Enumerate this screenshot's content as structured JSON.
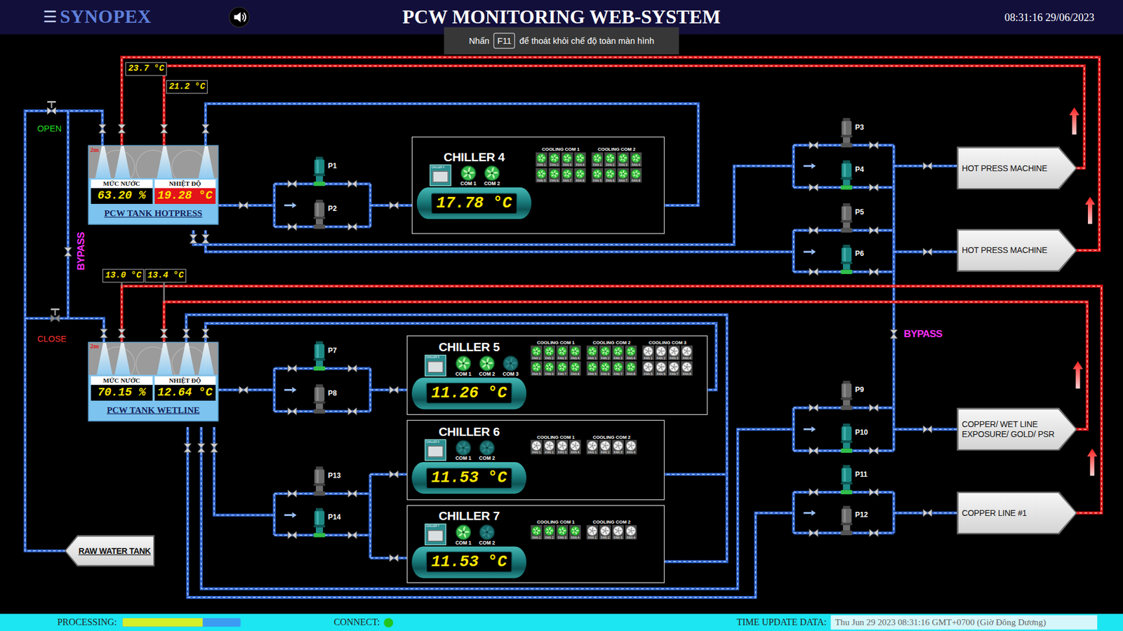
{
  "header": {
    "menu_icon": "☰",
    "logo": "SYNOPEX",
    "sound_on": true,
    "title": "PCW MONITORING WEB-SYSTEM",
    "clock": "08:31:16 29/06/2023"
  },
  "fullscreen_hint": {
    "before": "Nhấn",
    "key": "F11",
    "after": "để thoát khỏi chế độ toàn màn hình"
  },
  "sensors": [
    {
      "value": "23.7 °C"
    },
    {
      "value": "21.2 °C"
    },
    {
      "value": "13.0 °C"
    },
    {
      "value": "13.4 °C"
    }
  ],
  "manual_valves": [
    {
      "label": "OPEN",
      "open": true
    },
    {
      "label": "CLOSE",
      "open": false
    }
  ],
  "bypass_labels": [
    {
      "label": "BYPASS"
    },
    {
      "label": "BYPASS"
    }
  ],
  "tanks": [
    {
      "name": "PCW TANK HOTPRESS",
      "scale": "2m",
      "level_label": "MỨC NƯỚC",
      "level_value": "63.20 %",
      "temp_label": "NHIỆT ĐỘ",
      "temp_value": "19.28 °C",
      "temp_alarm": true
    },
    {
      "name": "PCW TANK WETLINE",
      "scale": "2m",
      "level_label": "MỨC NƯỚC",
      "level_value": "70.15 %",
      "temp_label": "NHIỆT ĐỘ",
      "temp_value": "12.64 °C",
      "temp_alarm": false
    }
  ],
  "pumps": [
    {
      "label": "P1",
      "running": true
    },
    {
      "label": "P2",
      "running": false
    },
    {
      "label": "P3",
      "running": false
    },
    {
      "label": "P4",
      "running": true
    },
    {
      "label": "P5",
      "running": false
    },
    {
      "label": "P6",
      "running": true
    },
    {
      "label": "P7",
      "running": true
    },
    {
      "label": "P8",
      "running": false
    },
    {
      "label": "P9",
      "running": false
    },
    {
      "label": "P10",
      "running": true
    },
    {
      "label": "P11",
      "running": true
    },
    {
      "label": "P12",
      "running": false
    },
    {
      "label": "P13",
      "running": false
    },
    {
      "label": "P14",
      "running": true
    }
  ],
  "chillers": [
    {
      "name": "CHILLER 4",
      "panel_label": "CHILLER 4",
      "temp": "17.78 °C",
      "coms": [
        {
          "label": "COM 1",
          "on": true
        },
        {
          "label": "COM 2",
          "on": true
        }
      ],
      "cooling": [
        {
          "label": "COOLING COM 1",
          "fans": [
            {
              "label": "FAN 1",
              "on": true
            },
            {
              "label": "FAN 2",
              "on": true
            },
            {
              "label": "FAN 3",
              "on": true
            },
            {
              "label": "FAN 4",
              "on": true
            },
            {
              "label": "FAN 5",
              "on": true
            },
            {
              "label": "FAN 6",
              "on": true
            },
            {
              "label": "FAN 7",
              "on": true
            },
            {
              "label": "FAN 8",
              "on": true
            }
          ]
        },
        {
          "label": "COOLING COM 2",
          "fans": [
            {
              "label": "FAN 1",
              "on": true
            },
            {
              "label": "FAN 2",
              "on": true
            },
            {
              "label": "FAN 3",
              "on": true
            },
            {
              "label": "FAN 4",
              "on": true
            },
            {
              "label": "FAN 5",
              "on": true
            },
            {
              "label": "FAN 6",
              "on": true
            },
            {
              "label": "FAN 7",
              "on": true
            },
            {
              "label": "FAN 8",
              "on": true
            }
          ]
        }
      ]
    },
    {
      "name": "CHILLER 5",
      "panel_label": "CHILLER 5",
      "temp": "11.26 °C",
      "coms": [
        {
          "label": "COM 1",
          "on": true
        },
        {
          "label": "COM 2",
          "on": true
        },
        {
          "label": "COM 3",
          "on": false
        }
      ],
      "cooling": [
        {
          "label": "COOLING COM 1",
          "fans": [
            {
              "label": "FAN 1",
              "on": true
            },
            {
              "label": "FAN 2",
              "on": true
            },
            {
              "label": "FAN 3",
              "on": true
            },
            {
              "label": "FAN 4",
              "on": true
            },
            {
              "label": "FAN 5",
              "on": true
            },
            {
              "label": "FAN 6",
              "on": true
            },
            {
              "label": "FAN 7",
              "on": true
            },
            {
              "label": "FAN 8",
              "on": true
            }
          ]
        },
        {
          "label": "COOLING COM 2",
          "fans": [
            {
              "label": "FAN 1",
              "on": true
            },
            {
              "label": "FAN 2",
              "on": true
            },
            {
              "label": "FAN 3",
              "on": true
            },
            {
              "label": "FAN 4",
              "on": true
            },
            {
              "label": "FAN 5",
              "on": true
            },
            {
              "label": "FAN 6",
              "on": true
            },
            {
              "label": "FAN 7",
              "on": true
            },
            {
              "label": "FAN 8",
              "on": true
            }
          ]
        },
        {
          "label": "COOLING COM 3",
          "fans": [
            {
              "label": "FAN 1",
              "on": false
            },
            {
              "label": "FAN 2",
              "on": false
            },
            {
              "label": "FAN 3",
              "on": false
            },
            {
              "label": "FAN 4",
              "on": false
            },
            {
              "label": "FAN 5",
              "on": false
            },
            {
              "label": "FAN 6",
              "on": false
            },
            {
              "label": "FAN 7",
              "on": false
            },
            {
              "label": "FAN 8",
              "on": false
            }
          ]
        }
      ]
    },
    {
      "name": "CHILLER 6",
      "panel_label": "CHILLER 6",
      "temp": "11.53 °C",
      "coms": [
        {
          "label": "COM 1",
          "on": false
        },
        {
          "label": "COM 2",
          "on": false
        }
      ],
      "cooling": [
        {
          "label": "COOLING COM 1",
          "fans": [
            {
              "label": "FAN 1",
              "on": false
            },
            {
              "label": "FAN 2",
              "on": false
            },
            {
              "label": "FAN 3",
              "on": false
            },
            {
              "label": "FAN 4",
              "on": false
            }
          ]
        },
        {
          "label": "COOLING COM 2",
          "fans": [
            {
              "label": "FAN 1",
              "on": false
            },
            {
              "label": "FAN 2",
              "on": false
            },
            {
              "label": "FAN 3",
              "on": false
            },
            {
              "label": "FAN 4",
              "on": false
            }
          ]
        }
      ]
    },
    {
      "name": "CHILLER 7",
      "panel_label": "CHILLER 7",
      "temp": "11.53 °C",
      "coms": [
        {
          "label": "COM 1",
          "on": true
        },
        {
          "label": "COM 2",
          "on": false
        }
      ],
      "cooling": [
        {
          "label": "COOLING COM 1",
          "fans": [
            {
              "label": "FAN 1",
              "on": true
            },
            {
              "label": "FAN 2",
              "on": true
            },
            {
              "label": "FAN 3",
              "on": true
            },
            {
              "label": "FAN 4",
              "on": true
            }
          ]
        },
        {
          "label": "COOLING COM 2",
          "fans": [
            {
              "label": "FAN 1",
              "on": false
            },
            {
              "label": "FAN 2",
              "on": false
            },
            {
              "label": "FAN 3",
              "on": false
            },
            {
              "label": "FAN 4",
              "on": false
            }
          ]
        }
      ]
    }
  ],
  "machines": [
    {
      "label": "HOT PRESS MACHINE"
    },
    {
      "label": "HOT PRESS MACHINE"
    },
    {
      "label": "COPPER/ WET LINE EXPOSURE/ GOLD/ PSR"
    },
    {
      "label": "COPPER LINE #1"
    }
  ],
  "raw_water_tank": {
    "label": "RAW WATER TANK"
  },
  "status_bar": {
    "processing_label": "PROCESSING:",
    "processing_level": 0.68,
    "connect_label": "CONNECT:",
    "connected": true,
    "time_label": "TIME UPDATE DATA:",
    "time_value": "Thu Jun 29 2023 08:31:16 GMT+0700 (Giờ Đông Dương)"
  }
}
